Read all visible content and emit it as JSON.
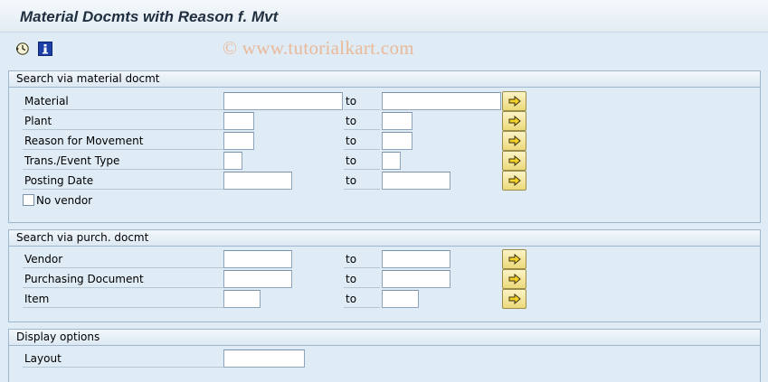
{
  "title": "Material Docmts with Reason f. Mvt",
  "toolbar": {
    "icons": [
      "execute-icon",
      "info-icon"
    ]
  },
  "watermark": "© www.tutorialkart.com",
  "to_label": "to",
  "groups": {
    "material": {
      "header": "Search via material docmt",
      "rows": [
        {
          "label": "Material",
          "from": "",
          "to": ""
        },
        {
          "label": "Plant",
          "from": "",
          "to": ""
        },
        {
          "label": "Reason for Movement",
          "from": "",
          "to": ""
        },
        {
          "label": "Trans./Event Type",
          "from": "",
          "to": ""
        },
        {
          "label": "Posting Date",
          "from": "",
          "to": ""
        }
      ],
      "checkbox": {
        "label": "No vendor",
        "checked": false
      }
    },
    "purch": {
      "header": "Search via purch. docmt",
      "rows": [
        {
          "label": "Vendor",
          "from": "",
          "to": ""
        },
        {
          "label": "Purchasing Document",
          "from": "",
          "to": ""
        },
        {
          "label": "Item",
          "from": "",
          "to": ""
        }
      ]
    },
    "display": {
      "header": "Display options",
      "layout_label": "Layout",
      "layout_value": ""
    }
  },
  "colors": {
    "background": "#dfebf5",
    "multi_select_button": "#ecd97a",
    "watermark": "#e9b99a"
  }
}
